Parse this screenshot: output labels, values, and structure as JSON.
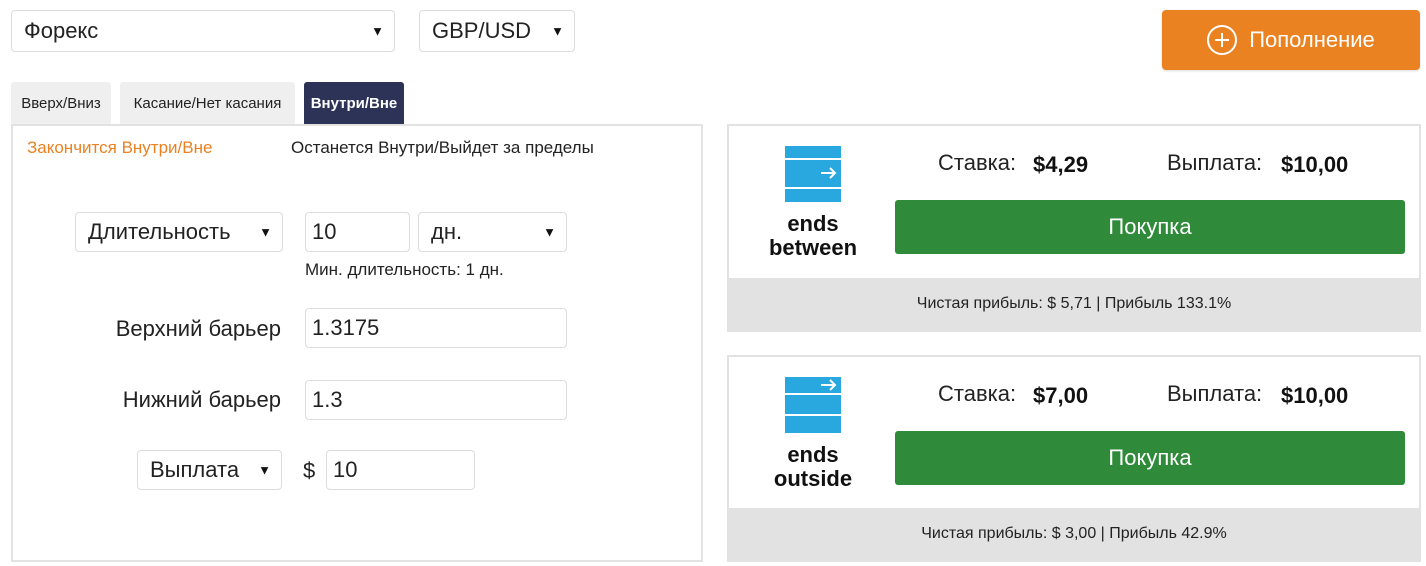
{
  "market_select": "Форекс",
  "symbol_select": "GBP/USD",
  "deposit_label": "Пополнение",
  "tabs": [
    "Вверх/Вниз",
    "Касание/Нет касания",
    "Внутри/Вне"
  ],
  "active_tab": "Внутри/Вне",
  "subtabs": [
    "Закончится Внутри/Вне",
    "Останется Внутри/Выйдет за пределы"
  ],
  "form": {
    "duration_select": "Длительность",
    "duration_value": "10",
    "duration_unit": "дн.",
    "min_duration_hint": "Мин. длительность: 1 дн.",
    "upper_barrier_label": "Верхний барьер",
    "upper_barrier_value": "1.3175",
    "lower_barrier_label": "Нижний барьер",
    "lower_barrier_value": "1.3",
    "payout_select": "Выплата",
    "currency_symbol": "$",
    "payout_value": "10"
  },
  "contracts": [
    {
      "label_line1": "ends",
      "label_line2": "between",
      "stake_label": "Ставка:",
      "stake_value": "$4,29",
      "payout_label": "Выплата:",
      "payout_value": "$10,00",
      "buy_label": "Покупка",
      "footer": "Чистая прибыль: $ 5,71 | Прибыль 133.1%"
    },
    {
      "label_line1": "ends",
      "label_line2": "outside",
      "stake_label": "Ставка:",
      "stake_value": "$7,00",
      "payout_label": "Выплата:",
      "payout_value": "$10,00",
      "buy_label": "Покупка",
      "footer": "Чистая прибыль: $ 3,00 | Прибыль 42.9%"
    }
  ],
  "colors": {
    "accent_orange": "#ea8222",
    "buy_green": "#2f8a39",
    "active_tab": "#2c3357",
    "contract_icon_blue": "#29a8e0"
  }
}
